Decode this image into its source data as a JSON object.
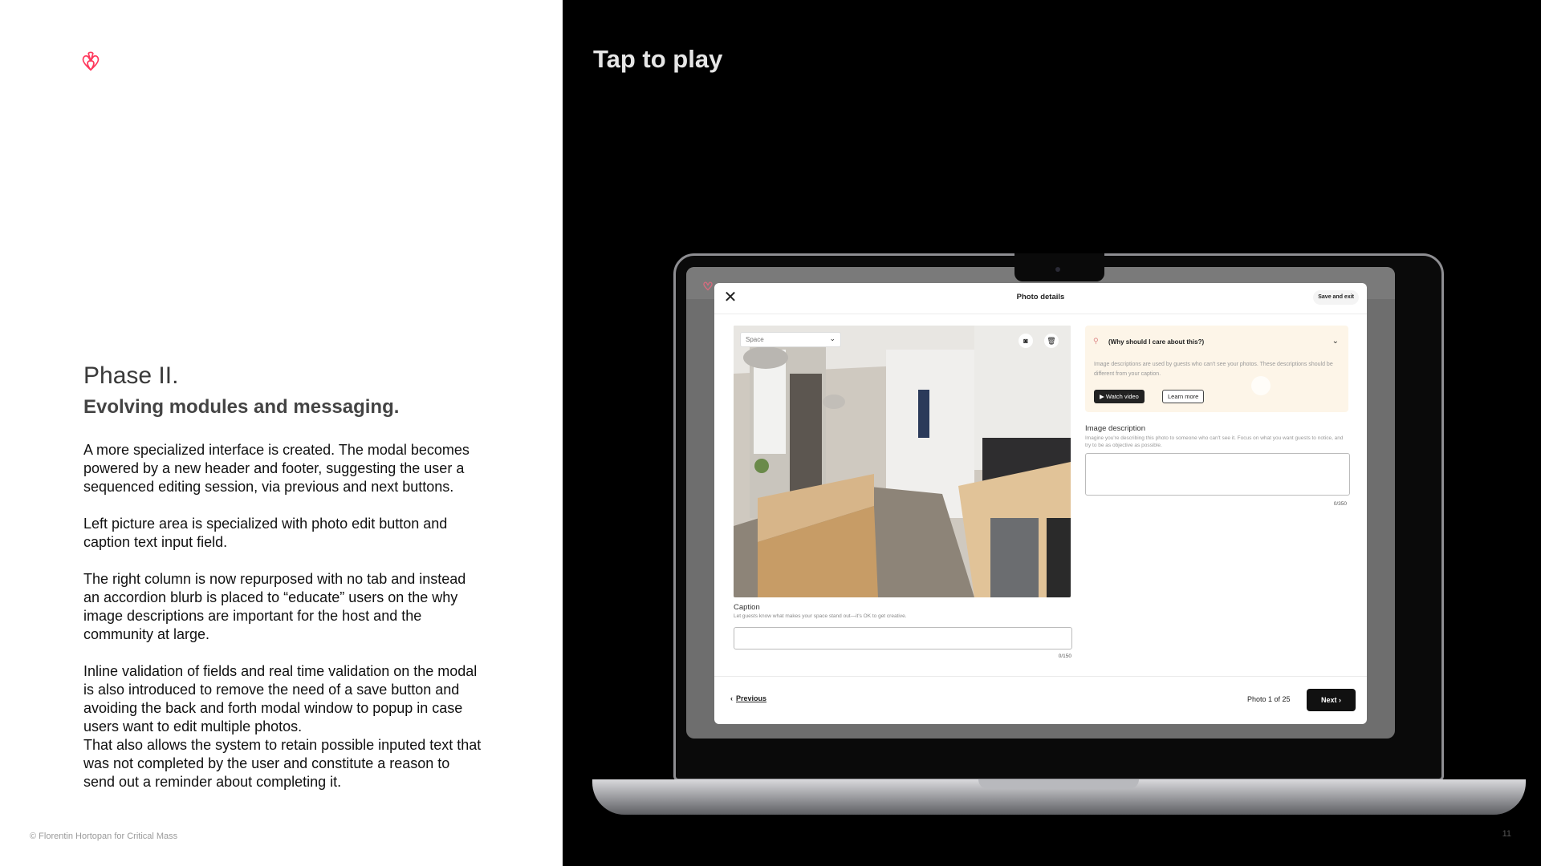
{
  "left": {
    "phase_title": "Phase II.",
    "phase_subtitle": "Evolving modules and messaging.",
    "paragraphs": [
      "A more specialized interface is created. The modal becomes powered by a new header and footer, suggesting the user a sequenced editing session, via previous and next buttons.",
      "Left picture area is specialized with photo edit button and caption text input field.",
      "The right column is now repurposed with no tab and instead an accordion blurb is placed to “educate” users on the why image descriptions are important for the host and the community at large.",
      "Inline validation of fields and real time validation on the modal is also introduced to remove the need of a save button and avoiding the back and forth modal window to popup in case users want to edit multiple photos.\nThat also allows the system to retain possible inputed text that was not completed by the user and constitute a reason to send out a reminder about completing it."
    ],
    "copyright": "© Florentin Hortopan for Critical Mass",
    "logo_icon": "airbnb-logo-icon",
    "brand_color": "#FF385C"
  },
  "right": {
    "tap_label": "Tap to play",
    "page_number": "11"
  },
  "modal": {
    "title": "Photo details",
    "save_exit": "Save and exit",
    "close_icon": "close-icon",
    "photo": {
      "space_select": "Space",
      "camera_icon": "camera-icon",
      "trash_icon": "trash-icon"
    },
    "caption": {
      "label": "Caption",
      "hint": "Let guests know what makes your space stand out—it's OK to get creative.",
      "count": "0/150"
    },
    "accordion": {
      "title": "(Why should I care about this?)",
      "body": "Image descriptions are used by guests who can't see your photos. These descriptions should be different from your caption.",
      "watch_video": "▶ Watch video",
      "learn_more": "Learn more"
    },
    "description": {
      "label": "Image description",
      "hint": "Imagine you're describing this photo to someone who can't see it. Focus on what you want guests to notice, and try to be as objective as possible.",
      "count": "0/350"
    },
    "footer": {
      "previous": "Previous",
      "counter": "Photo 1 of 25",
      "next": "Next"
    }
  }
}
